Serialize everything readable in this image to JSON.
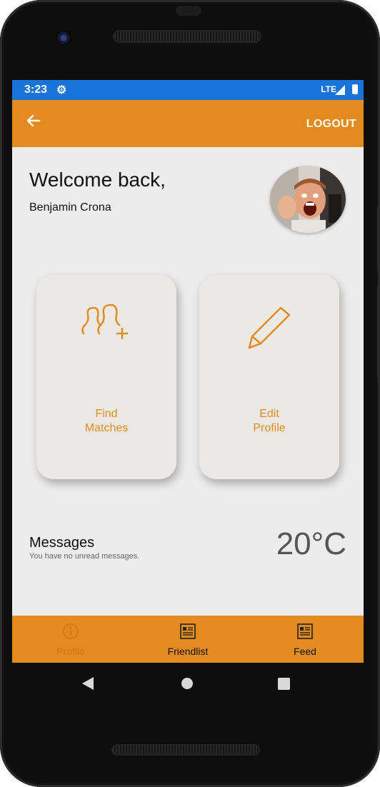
{
  "colors": {
    "accent": "#e38b1e",
    "status_bar": "#1a73d9",
    "screen_bg": "#ececec"
  },
  "status_bar": {
    "time": "3:23",
    "network": "LTE",
    "icons": [
      "gear-icon",
      "signal-icon",
      "battery-icon"
    ]
  },
  "app_bar": {
    "back_icon": "arrow-left-icon",
    "logout_label": "LOGOUT"
  },
  "header": {
    "welcome": "Welcome back,",
    "username": "Benjamin Crona"
  },
  "cards": [
    {
      "label_line1": "Find",
      "label_line2": "Matches",
      "icon": "find-matches-icon"
    },
    {
      "label_line1": "Edit",
      "label_line2": "Profile",
      "icon": "pencil-icon"
    }
  ],
  "messages": {
    "title": "Messages",
    "subtitle": "You have no unread messages."
  },
  "weather": {
    "temperature": "20°C"
  },
  "bottom_nav": {
    "items": [
      {
        "label": "Profile",
        "icon": "info-icon",
        "active": true
      },
      {
        "label": "Friendlist",
        "icon": "list-icon",
        "active": false
      },
      {
        "label": "Feed",
        "icon": "feed-icon",
        "active": false
      }
    ]
  }
}
